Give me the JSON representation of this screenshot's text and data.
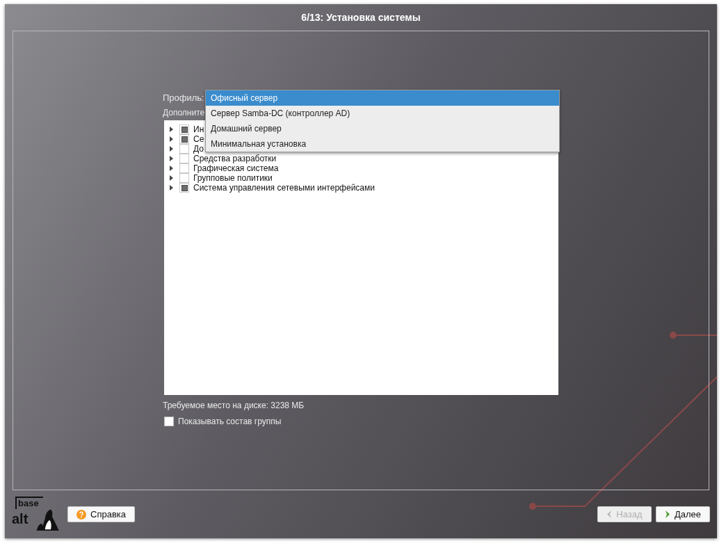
{
  "window": {
    "title": "6/13: Установка системы"
  },
  "profile": {
    "label": "Профиль:",
    "options": [
      {
        "label": "Офисный сервер",
        "selected": true
      },
      {
        "label": "Сервер Samba-DC (контроллер AD)",
        "selected": false
      },
      {
        "label": "Домашний сервер",
        "selected": false
      },
      {
        "label": "Минимальная установка",
        "selected": false
      }
    ]
  },
  "extra_label": "Дополните",
  "groups": [
    {
      "label": "Ин",
      "checked": true
    },
    {
      "label": "Се",
      "checked": true
    },
    {
      "label": "До",
      "checked": false
    },
    {
      "label": "Средства разработки",
      "checked": false
    },
    {
      "label": "Графическая система",
      "checked": false
    },
    {
      "label": "Групповые политики",
      "checked": false
    },
    {
      "label": "Система управления сетевыми интерфейсами",
      "checked": true
    }
  ],
  "disk_space": "Требуемое место на диске: 3238 МБ",
  "show_group": {
    "label": "Показывать состав группы",
    "checked": false
  },
  "logo": {
    "line1": "base",
    "line2": "alt"
  },
  "buttons": [
    {
      "kind": "help",
      "label": "Справка",
      "disabled": false
    },
    {
      "kind": "back",
      "label": "Назад",
      "disabled": true
    },
    {
      "kind": "next",
      "label": "Далее",
      "disabled": false
    }
  ]
}
